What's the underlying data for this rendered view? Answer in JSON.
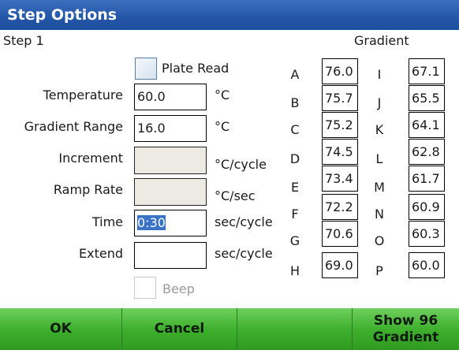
{
  "window": {
    "title": "Step Options"
  },
  "step_label": "Step 1",
  "plate_read": {
    "label": "Plate Read",
    "checked": false
  },
  "fields": {
    "temperature": {
      "label": "Temperature",
      "value": "60.0",
      "unit": "°C"
    },
    "gradient_range": {
      "label": "Gradient Range",
      "value": "16.0",
      "unit": "°C"
    },
    "increment": {
      "label": "Increment",
      "value": "",
      "unit": "°C/cycle"
    },
    "ramp_rate": {
      "label": "Ramp Rate",
      "value": "",
      "unit": "°C/sec"
    },
    "time": {
      "label": "Time",
      "value": "0:30",
      "unit": "sec/cycle"
    },
    "extend": {
      "label": "Extend",
      "value": "",
      "unit": "sec/cycle"
    }
  },
  "beep": {
    "label": "Beep",
    "checked": false
  },
  "gradient": {
    "title": "Gradient",
    "left": [
      {
        "letter": "A",
        "value": "76.0"
      },
      {
        "letter": "B",
        "value": "75.7"
      },
      {
        "letter": "C",
        "value": "75.2"
      },
      {
        "letter": "D",
        "value": "74.5"
      },
      {
        "letter": "E",
        "value": "73.4"
      },
      {
        "letter": "F",
        "value": "72.2"
      },
      {
        "letter": "G",
        "value": "70.6"
      },
      {
        "letter": "H",
        "value": "69.0"
      }
    ],
    "right": [
      {
        "letter": "I",
        "value": "67.1"
      },
      {
        "letter": "J",
        "value": "65.5"
      },
      {
        "letter": "K",
        "value": "64.1"
      },
      {
        "letter": "L",
        "value": "62.8"
      },
      {
        "letter": "M",
        "value": "61.7"
      },
      {
        "letter": "N",
        "value": "60.9"
      },
      {
        "letter": "O",
        "value": "60.3"
      },
      {
        "letter": "P",
        "value": "60.0"
      }
    ]
  },
  "softkeys": {
    "ok": "OK",
    "cancel": "Cancel",
    "blank": "",
    "show96_line1": "Show 96",
    "show96_line2": "Gradient"
  },
  "colors": {
    "title_bar": "#2456a8",
    "softkey_bar": "#3fb02e",
    "selection": "#3a74c9",
    "disabled_field": "#ede9e3"
  }
}
